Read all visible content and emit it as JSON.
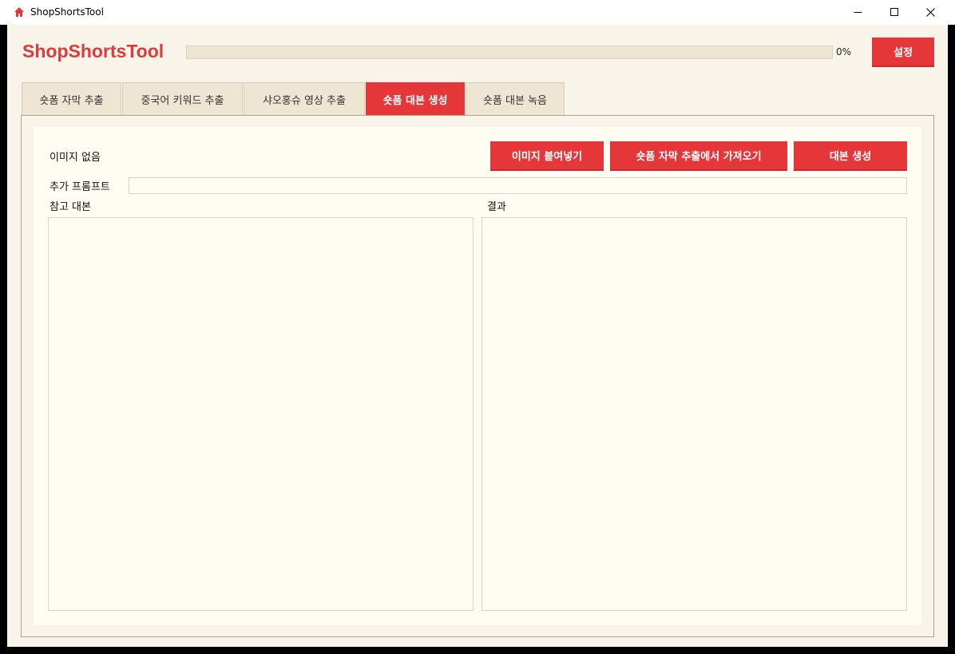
{
  "window": {
    "title": "ShopShortsTool"
  },
  "header": {
    "app_name": "ShopShortsTool",
    "progress_value": 0,
    "progress_text": "0%",
    "settings_label": "설정"
  },
  "tabs": [
    {
      "label": "숏폼 자막 추출",
      "active": false
    },
    {
      "label": "중국어 키워드 추출",
      "active": false
    },
    {
      "label": "샤오홍슈 영상 추출",
      "active": false
    },
    {
      "label": "숏폼 대본 생성",
      "active": true
    },
    {
      "label": "숏폼 대본 녹음",
      "active": false
    }
  ],
  "panel": {
    "image_status": "이미지 없음",
    "paste_image_label": "이미지 붙여넣기",
    "import_subtitle_label": "숏폼 자막 추출에서 가져오기",
    "generate_label": "대본 생성",
    "extra_prompt_label": "추가 프롬프트",
    "extra_prompt_value": "",
    "reference_label": "참고 대본",
    "reference_value": "",
    "result_label": "결과",
    "result_value": ""
  },
  "colors": {
    "accent": "#e5373a",
    "background": "#f8f4ea",
    "tab_inactive": "#eee5d3",
    "field_bg": "#fffcf3"
  },
  "icons": {
    "app": "house-icon",
    "minimize": "minimize-icon",
    "maximize": "maximize-icon",
    "close": "close-icon"
  }
}
